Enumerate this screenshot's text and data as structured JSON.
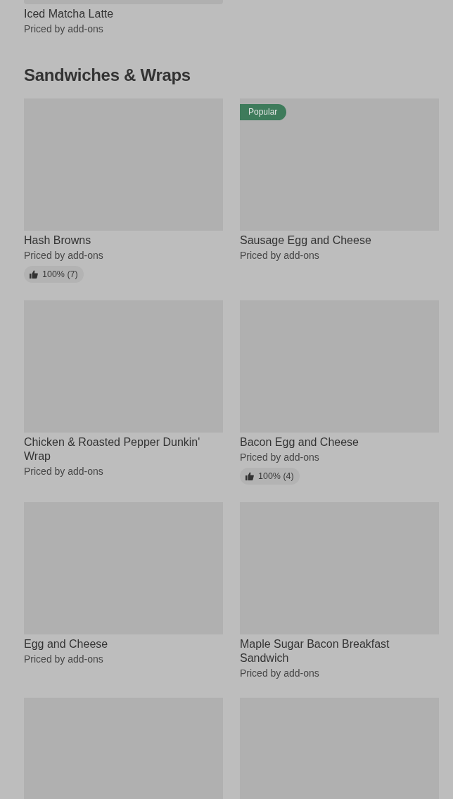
{
  "sections": [
    {
      "rows": [
        {
          "items": [
            {
              "kind": "cut_top",
              "name": "Iced Matcha Latte",
              "price": "Priced by add-ons"
            }
          ]
        }
      ]
    },
    {
      "title": "Sandwiches & Wraps",
      "rows": [
        {
          "items": [
            {
              "kind": "full",
              "name": "Hash Browns",
              "price": "Priced by add-ons",
              "rating": "100% (7)"
            },
            {
              "kind": "full",
              "badge": "Popular",
              "name": "Sausage Egg and Cheese",
              "price": "Priced by add-ons"
            }
          ]
        },
        {
          "items": [
            {
              "kind": "full",
              "name": "Chicken & Roasted Pepper Dunkin' Wrap",
              "price": "Priced by add-ons"
            },
            {
              "kind": "full",
              "name": "Bacon Egg and Cheese",
              "price": "Priced by add-ons",
              "rating": "100% (4)"
            }
          ]
        },
        {
          "items": [
            {
              "kind": "full",
              "name": "Egg and Cheese",
              "price": "Priced by add-ons"
            },
            {
              "kind": "full",
              "name": "Maple Sugar Bacon Breakfast Sandwich",
              "price": "Priced by add-ons"
            }
          ]
        },
        {
          "items": [
            {
              "kind": "cut_bottom"
            },
            {
              "kind": "cut_bottom"
            }
          ]
        }
      ]
    }
  ]
}
